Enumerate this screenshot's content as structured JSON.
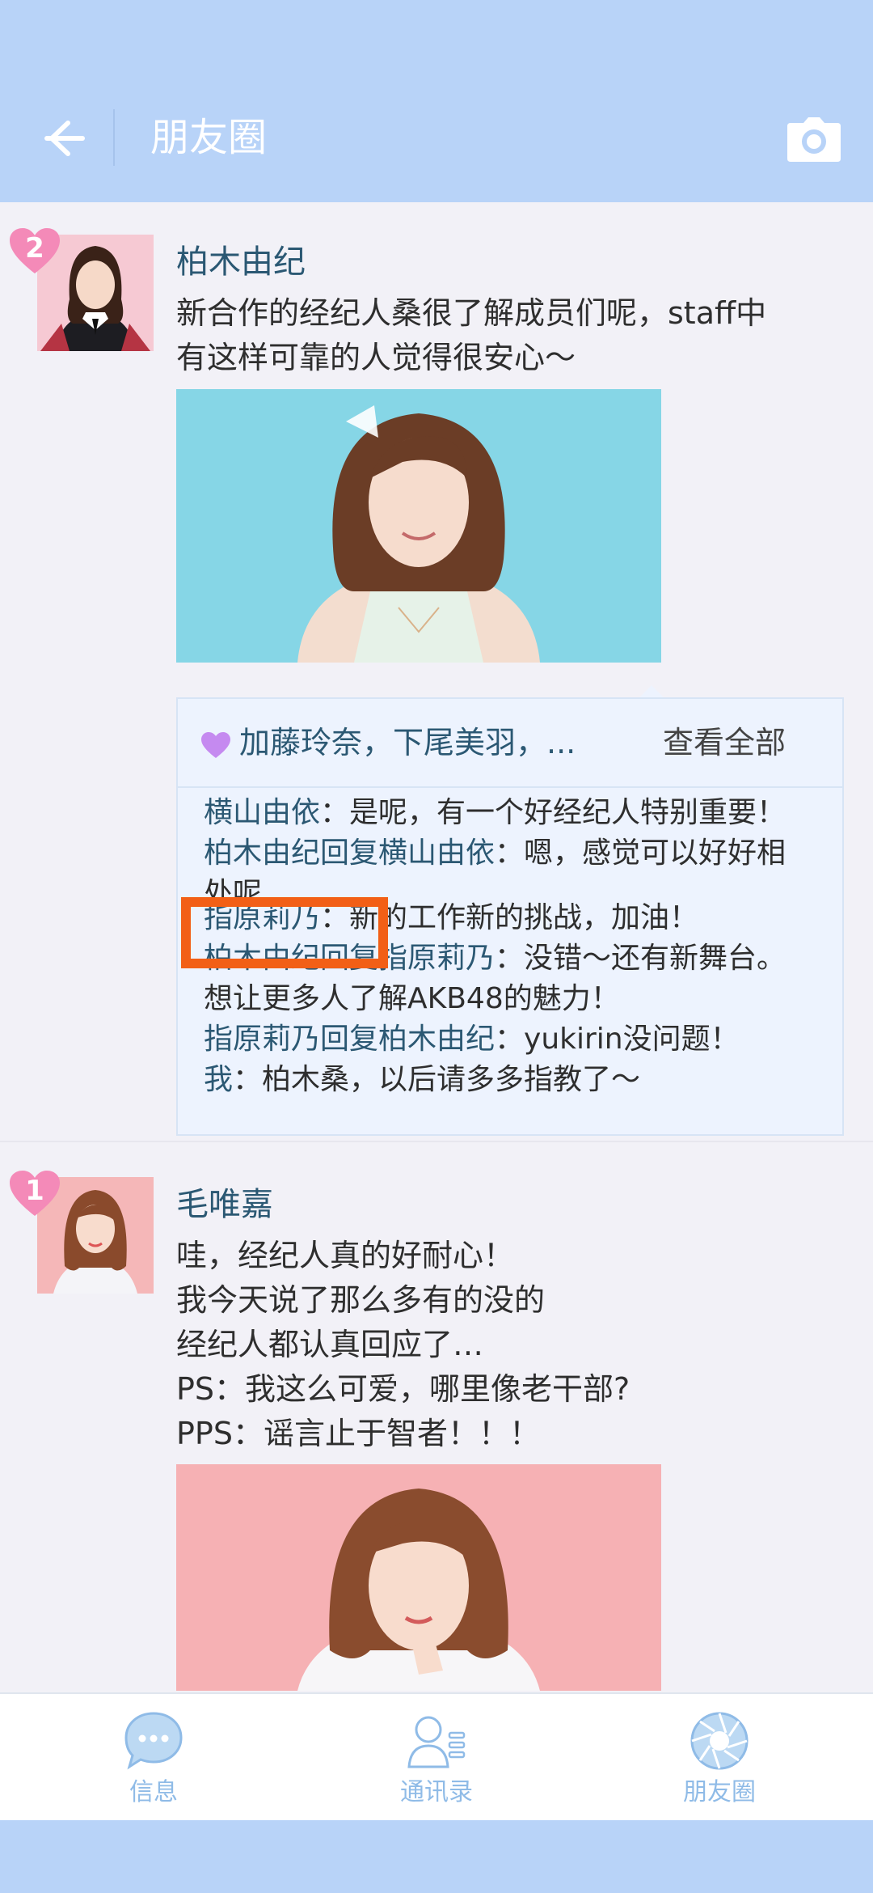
{
  "header": {
    "title": "朋友圈",
    "back_icon": "back-arrow-icon",
    "camera_icon": "camera-icon"
  },
  "posts": [
    {
      "rank": "2",
      "author": "柏木由纪",
      "text_lines": [
        "新合作的经纪人桑很了解成员们呢，staff中",
        "有这样可靠的人觉得很安心～"
      ],
      "likes": "加藤玲奈，下尾美羽，...",
      "view_all": "查看全部",
      "comments": [
        {
          "who": "横山由依",
          "text": "：是呢，有一个好经纪人特别重要！"
        },
        {
          "who": "柏木由纪回复横山由依",
          "text": "：嗯，感觉可以好好相"
        },
        {
          "who": "",
          "text": "处呢"
        },
        {
          "who": "指原莉乃",
          "text": "：新的工作新的挑战，加油！"
        },
        {
          "who": "柏木由纪回复指原莉乃",
          "text": "：没错～还有新舞台。"
        },
        {
          "who": "",
          "text": "想让更多人了解AKB48的魅力！"
        },
        {
          "who": "指原莉乃回复柏木由纪",
          "text": "：yukirin没问题！"
        },
        {
          "who": "我",
          "text": "：柏木桑，以后请多多指教了～"
        }
      ]
    },
    {
      "rank": "1",
      "author": "毛唯嘉",
      "text_lines": [
        "哇，经纪人真的好耐心！",
        "我今天说了那么多有的没的",
        "经纪人都认真回应了…",
        "PS：我这么可爱，哪里像老干部?",
        "PPS：谣言止于智者！！！"
      ]
    }
  ],
  "tabs": [
    {
      "label": "信息",
      "icon": "chat-bubble-icon"
    },
    {
      "label": "通讯录",
      "icon": "contacts-icon"
    },
    {
      "label": "朋友圈",
      "icon": "aperture-icon"
    }
  ],
  "colors": {
    "header_bg": "#b8d3f8",
    "name_color": "#2b5873",
    "highlight": "#f25f16",
    "tab_color": "#8fbbe7"
  }
}
